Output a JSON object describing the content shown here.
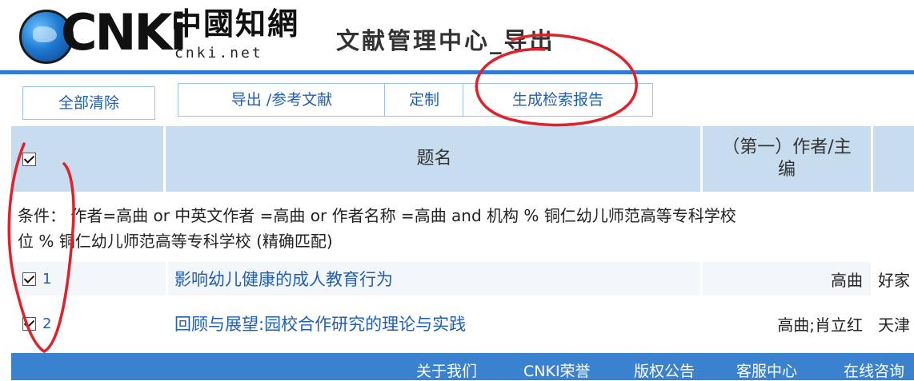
{
  "header": {
    "logo_text": "CNKi",
    "logo_cn": "中國知網",
    "logo_domain": "cnki.net",
    "page_title": "文献管理中心_导出"
  },
  "toolbar": {
    "clear_all": "全部清除",
    "export_refs": "导出 /参考文献",
    "customize": "定制",
    "gen_report": "生成检索报告"
  },
  "table": {
    "col_title": "题名",
    "col_author_line1": "（第一）作者/主",
    "col_author_line2": "编",
    "condition_line1": "条件： 作者=高曲 or 中英文作者 =高曲 or 作者名称 =高曲 and 机构 % 铜仁幼儿师范高等专科学校",
    "condition_line2": "位 % 铜仁幼儿师范高等专科学校 (精确匹配)",
    "rows": [
      {
        "num": "1",
        "title": "影响幼儿健康的成人教育行为",
        "author": "高曲",
        "source": "好家"
      },
      {
        "num": "2",
        "title": "回顾与展望:园校合作研究的理论与实践",
        "author": "高曲;肖立红",
        "source": "天津"
      }
    ]
  },
  "footer": {
    "links": [
      "关于我们",
      "CNKI荣誉",
      "版权公告",
      "客服中心",
      "在线咨询"
    ]
  },
  "colors": {
    "accent": "#2f7bd6",
    "header_bg": "#c7dcee",
    "link": "#1f5fb4",
    "footer_bg": "#3a82cf",
    "annotation": "#e0202a"
  }
}
